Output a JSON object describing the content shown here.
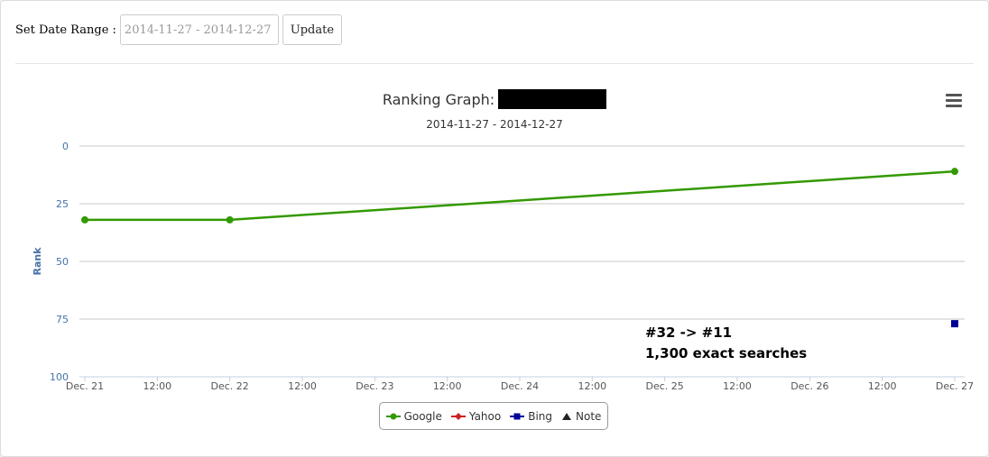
{
  "controls": {
    "range_label": "Set Date Range :",
    "range_value": "2014-11-27 - 2014-12-27",
    "update_label": "Update"
  },
  "chart_data": {
    "type": "line",
    "title": "Ranking Graph:",
    "subtitle": "2014-11-27 - 2014-12-27",
    "ylabel": "Rank",
    "xlabel": "",
    "y_reversed": true,
    "ylim": [
      0,
      100
    ],
    "y_ticks": [
      0,
      25,
      50,
      75,
      100
    ],
    "x_ticks": [
      "Dec. 21",
      "12:00",
      "Dec. 22",
      "12:00",
      "Dec. 23",
      "12:00",
      "Dec. 24",
      "12:00",
      "Dec. 25",
      "12:00",
      "Dec. 26",
      "12:00",
      "Dec. 27"
    ],
    "grid": true,
    "series": [
      {
        "name": "Google",
        "color": "#339900",
        "marker": "circle",
        "points": [
          {
            "x": "2014-12-21",
            "y": 32
          },
          {
            "x": "2014-12-22",
            "y": 32
          },
          {
            "x": "2014-12-27",
            "y": 11
          }
        ]
      },
      {
        "name": "Yahoo",
        "color": "#cc2222",
        "marker": "diamond",
        "points": []
      },
      {
        "name": "Bing",
        "color": "#000099",
        "marker": "square",
        "points": [
          {
            "x": "2014-12-27",
            "y": 77
          }
        ]
      },
      {
        "name": "Note",
        "color": "#222222",
        "marker": "triangle",
        "points": []
      }
    ],
    "annotation": [
      "#32 -> #11",
      "1,300 exact searches"
    ],
    "legend_position": "bottom-center"
  }
}
